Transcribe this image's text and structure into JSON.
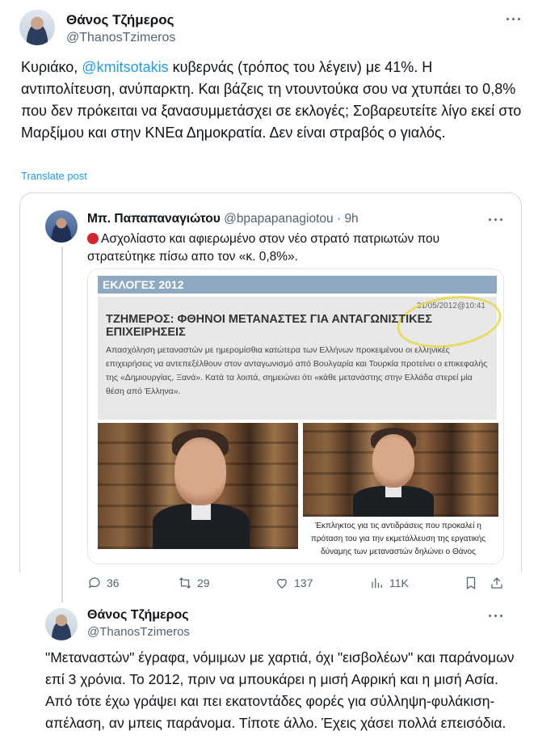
{
  "main_tweet": {
    "author_name": "Θάνος Τζήμερος",
    "author_handle": "@ThanosTzimeros",
    "more_icon": "more-dots-icon",
    "text_prefix": "Κυριάκο, ",
    "mention": "@kmitsotakis",
    "text_suffix": " κυβερνάς (τρόπος του λέγειν) με 41%. Η αντιπολίτευση, ανύπαρκτη. Και βάζεις τη ντουντούκα σου να χτυπάει το 0,8% που δεν πρόκειται να ξανασυμμετάσχει σε εκλογές; Σοβαρευτείτε λίγο εκεί στο Μαρξίμου και στην ΚΝΕα Δημοκρατία. Δεν είναι στραβός ο γιαλός.",
    "translate_label": "Translate post"
  },
  "quoted_tweet": {
    "author_name": "Μπ. Παπαπαναγιώτου",
    "author_handle": "@bpapapanagiotou",
    "separator": "·",
    "time": "9h",
    "status_icon": "red-circle-icon",
    "text": "Ασχολίαστο και αφιερωμένο στον νέο στρατό πατριωτών που στρατεύτηκε πίσω απο τον «κ. 0,8%».",
    "clipping": {
      "header": "ΕΚΛΟΓΕΣ 2012",
      "date": "31/05/2012@10:41",
      "title": "ΤΖΗΜΕΡΟΣ: ΦΘΗΝΟΙ ΜΕΤΑΝΑΣΤΕΣ ΓΙΑ ΑΝΤΑΓΩΝΙΣΤΙΚΕΣ ΕΠΙΧΕΙΡΗΣΕΙΣ",
      "body": "Απασχόληση μεταναστών με ημερομίσθια κατώτερα των Ελλήνων προκειμένου οι ελληνικές επιχειρήσεις να αντεπεξέλθουν στον ανταγωνισμό από Βουλγαρία και Τουρκία προτείνει ο επικεφαλής της «Δημιουργίας, Ξανά». Κατά τα λοιπά, σημειώνει ότι «κάθε μετανάστης στην Ελλάδα στερεί μία θέση από Έλληνα».",
      "caption": "Έκπληκτος για τις αντιδράσεις που προκαλεί η πρόταση του για την εκμετάλλευση της εργατικής δύναμης των μεταναστών δηλώνει ο Θάνος"
    },
    "actions": {
      "replies": "36",
      "reposts": "29",
      "likes": "137",
      "views": "11K"
    }
  },
  "reply_tweet": {
    "author_name": "Θάνος Τζήμερος",
    "author_handle": "@ThanosTzimeros",
    "text": "\"Μεταναστών\" έγραφα, νόμιμων με χαρτιά, όχι \"εισβολέων\" και παράνομων επί 3 χρόνια. Το 2012, πριν να μπουκάρει η μισή Αφρική και η μισή Ασία. Από τότε έχω γράψει και πει εκατοντάδες φορές για σύλληψη-φυλάκιση-απέλαση, αν μπεις παράνομα. Τίποτε άλλο. Έχεις χάσει πολλά επεισόδια."
  },
  "colors": {
    "link": "#1d9bf0",
    "secondary_text": "#536471",
    "border": "#cfd9de"
  }
}
